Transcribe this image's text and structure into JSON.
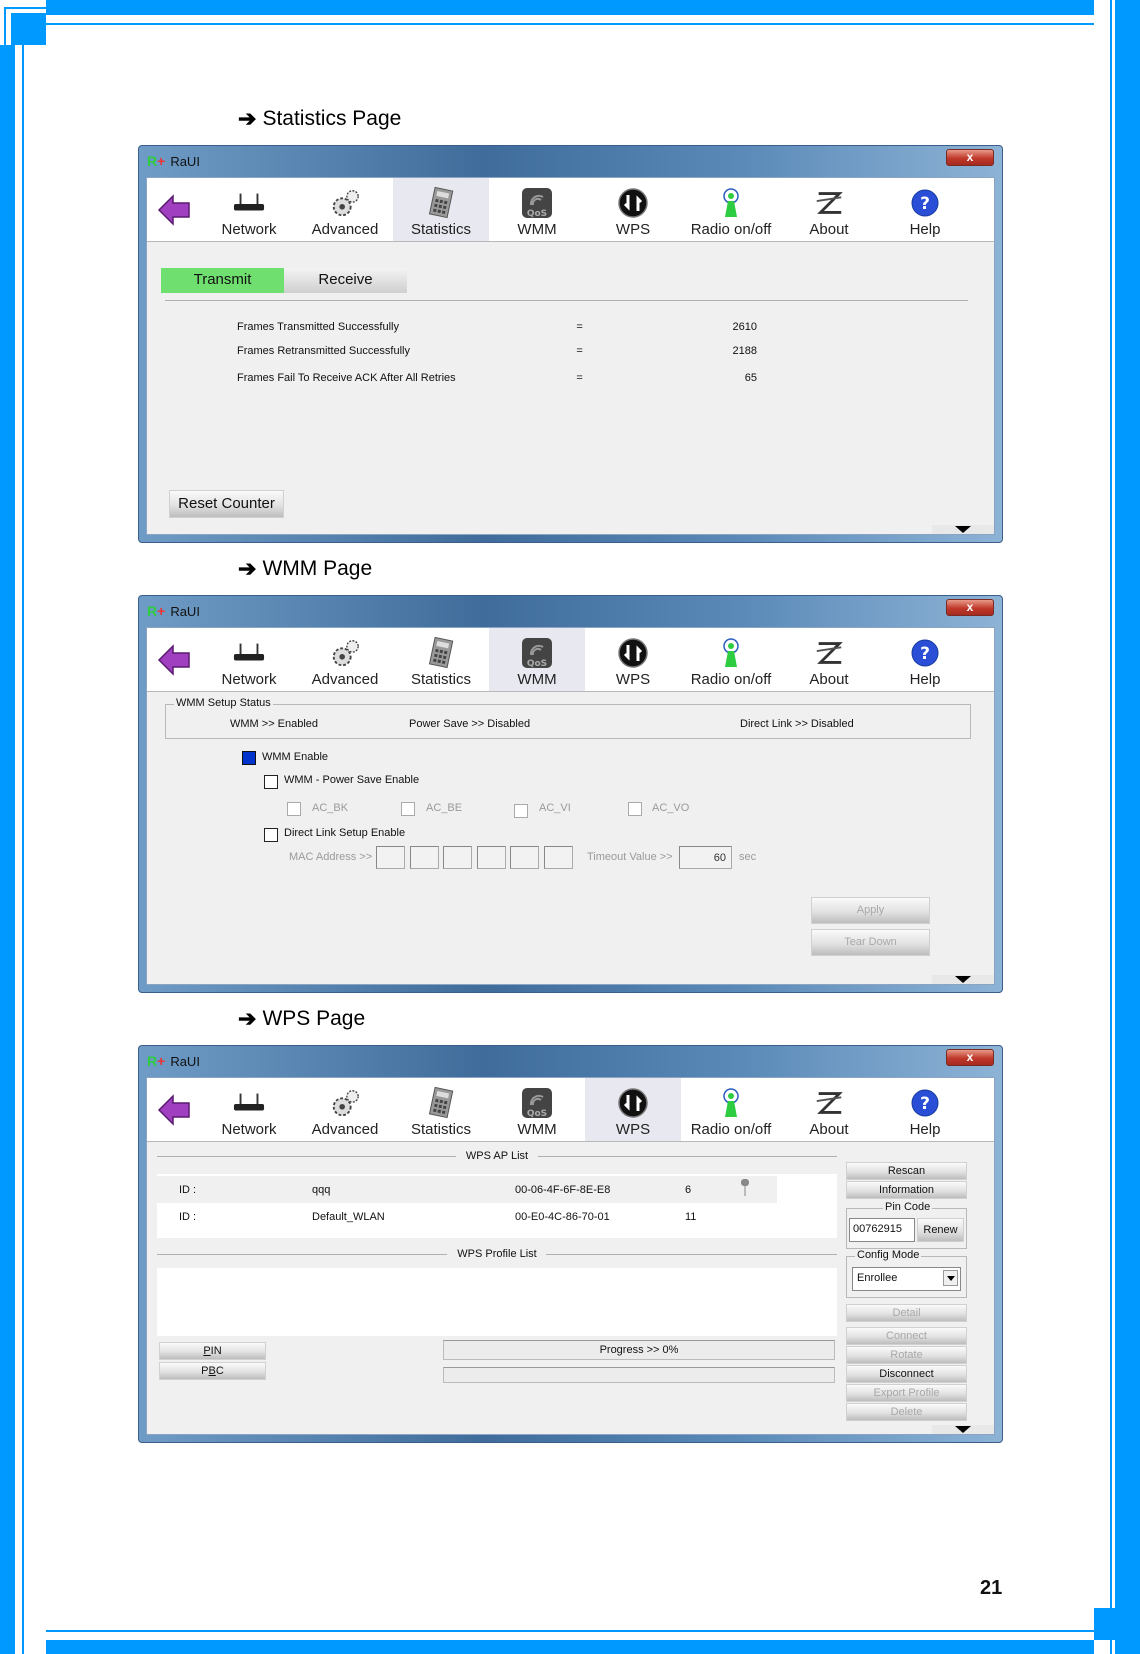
{
  "page": {
    "number": "21",
    "colors": {
      "frame": "#0099ff",
      "active_tab": "#6fe06f",
      "checkbox_checked": "#0033cc"
    }
  },
  "sections": [
    {
      "heading": "Statistics Page",
      "arrow_icon": "right-arrow-icon"
    },
    {
      "heading": "WMM Page",
      "arrow_icon": "right-arrow-icon"
    },
    {
      "heading": "WPS Page",
      "arrow_icon": "right-arrow-icon"
    }
  ],
  "window": {
    "title": "RaUI",
    "close_label": "x",
    "toolbar": [
      {
        "label": "Network",
        "icon": "router-icon"
      },
      {
        "label": "Advanced",
        "icon": "gears-icon"
      },
      {
        "label": "Statistics",
        "icon": "calculator-icon"
      },
      {
        "label": "WMM",
        "icon": "qos-icon"
      },
      {
        "label": "WPS",
        "icon": "wps-icon"
      },
      {
        "label": "Radio on/off",
        "icon": "antenna-icon"
      },
      {
        "label": "About",
        "icon": "about-icon"
      },
      {
        "label": "Help",
        "icon": "help-icon"
      }
    ]
  },
  "statistics": {
    "active_toolbar": "Statistics",
    "tabs": [
      {
        "label": "Transmit",
        "active": true
      },
      {
        "label": "Receive",
        "active": false
      }
    ],
    "rows": [
      {
        "label": "Frames Transmitted Successfully",
        "eq": "=",
        "value": "2610"
      },
      {
        "label": "Frames Retransmitted Successfully",
        "eq": "=",
        "value": "2188"
      },
      {
        "label": "Frames Fail To Receive ACK After All Retries",
        "eq": "=",
        "value": "65"
      }
    ],
    "reset_label": "Reset Counter"
  },
  "wmm": {
    "active_toolbar": "WMM",
    "status_group": "WMM Setup Status",
    "status": {
      "wmm": "WMM >> Enabled",
      "power_save": "Power Save >> Disabled",
      "direct_link": "Direct Link >> Disabled"
    },
    "wmm_enable": {
      "label": "WMM Enable",
      "checked": true
    },
    "power_save_enable": {
      "label": "WMM - Power Save Enable",
      "checked": false
    },
    "ac": [
      {
        "label": "AC_BK",
        "checked": false
      },
      {
        "label": "AC_BE",
        "checked": false
      },
      {
        "label": "AC_VI",
        "checked": false
      },
      {
        "label": "AC_VO",
        "checked": false
      }
    ],
    "direct_link_enable": {
      "label": "Direct Link Setup Enable",
      "checked": false
    },
    "mac_label": "MAC Address >>",
    "mac_values": [
      "",
      "",
      "",
      "",
      "",
      ""
    ],
    "timeout_label": "Timeout Value >>",
    "timeout_value": "60",
    "timeout_unit": "sec",
    "apply_label": "Apply",
    "teardown_label": "Tear Down"
  },
  "wps": {
    "active_toolbar": "WPS",
    "ap_list_title": "WPS AP List",
    "ap_list": [
      {
        "id_label": "ID :",
        "ssid": "qqq",
        "bssid": "00-06-4F-6F-8E-E8",
        "channel": "6",
        "locked": true
      },
      {
        "id_label": "ID :",
        "ssid": "Default_WLAN",
        "bssid": "00-E0-4C-86-70-01",
        "channel": "11",
        "locked": false
      }
    ],
    "profile_list_title": "WPS Profile List",
    "pin_label": "PIN",
    "pbc_label": "PBC",
    "progress_text": "Progress >> 0%",
    "progress_percent": 0,
    "buttons": {
      "rescan": "Rescan",
      "information": "Information",
      "detail": "Detail",
      "connect": "Connect",
      "rotate": "Rotate",
      "disconnect": "Disconnect",
      "export_profile": "Export Profile",
      "delete": "Delete"
    },
    "pin_code_group": "Pin Code",
    "pin_code": "00762915",
    "renew_label": "Renew",
    "config_mode_group": "Config Mode",
    "config_mode": "Enrollee"
  }
}
